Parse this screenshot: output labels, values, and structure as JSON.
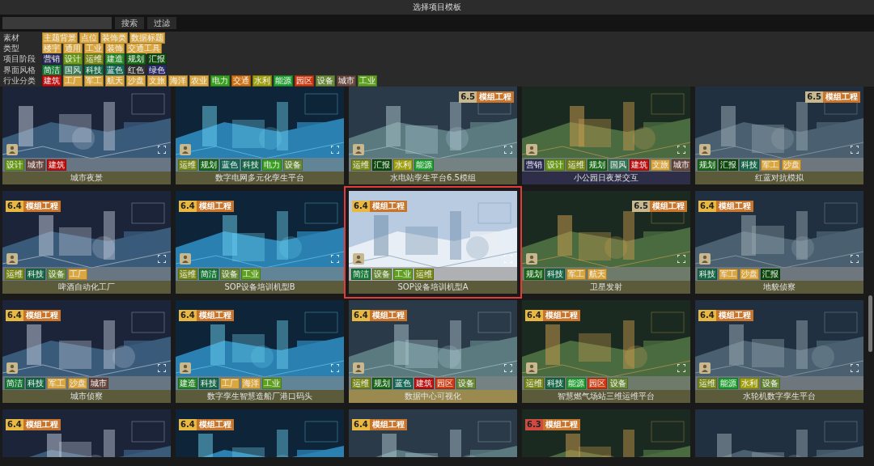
{
  "window": {
    "title": "选择项目模板"
  },
  "search": {
    "button": "搜索",
    "filter_button": "过滤"
  },
  "filters": [
    {
      "label": "素材",
      "tags": [
        {
          "text": "主题背景",
          "color": "#d9a640"
        },
        {
          "text": "点位",
          "color": "#d9a640"
        },
        {
          "text": "装饰类",
          "color": "#d9a640"
        },
        {
          "text": "数据标题",
          "color": "#d9a640"
        }
      ]
    },
    {
      "label": "类型",
      "tags": [
        {
          "text": "楼宇",
          "color": "#d9a640"
        },
        {
          "text": "通用",
          "color": "#d9a640"
        },
        {
          "text": "工业",
          "color": "#d9a640"
        },
        {
          "text": "装饰",
          "color": "#d9a640"
        },
        {
          "text": "交通工具",
          "color": "#d9a640"
        }
      ]
    },
    {
      "label": "项目阶段",
      "tags": [
        {
          "text": "营销",
          "color": "#2a2a55"
        },
        {
          "text": "设计",
          "color": "#6a9a1a"
        },
        {
          "text": "运维",
          "color": "#7a8a1a"
        },
        {
          "text": "建造",
          "color": "#2a8a2a"
        },
        {
          "text": "规划",
          "color": "#1a6a1a"
        },
        {
          "text": "汇报",
          "color": "#0f4a0f"
        }
      ]
    },
    {
      "label": "界面风格",
      "tags": [
        {
          "text": "简洁",
          "color": "#1a7a3a"
        },
        {
          "text": "国风",
          "color": "#3a7a5a"
        },
        {
          "text": "科技",
          "color": "#1a6a4a"
        },
        {
          "text": "蓝色",
          "color": "#1a6a5a"
        },
        {
          "text": "红色",
          "color": "#333333"
        },
        {
          "text": "绿色",
          "color": "#2a2a66"
        }
      ]
    },
    {
      "label": "行业分类",
      "tags": [
        {
          "text": "建筑",
          "color": "#c01010"
        },
        {
          "text": "工厂",
          "color": "#d9a640"
        },
        {
          "text": "军工",
          "color": "#d9a640"
        },
        {
          "text": "航天",
          "color": "#d9a640"
        },
        {
          "text": "沙盘",
          "color": "#d9a640"
        },
        {
          "text": "文旅",
          "color": "#d9a640"
        },
        {
          "text": "海洋",
          "color": "#d9a640"
        },
        {
          "text": "农业",
          "color": "#d9a640"
        },
        {
          "text": "电力",
          "color": "#3aa020"
        },
        {
          "text": "交通",
          "color": "#d07010"
        },
        {
          "text": "水利",
          "color": "#a0a010"
        },
        {
          "text": "能源",
          "color": "#20a030"
        },
        {
          "text": "园区",
          "color": "#d03a10"
        },
        {
          "text": "设备",
          "color": "#6a8a3a"
        },
        {
          "text": "城市",
          "color": "#6a4a40"
        },
        {
          "text": "工业",
          "color": "#60a020"
        }
      ]
    }
  ],
  "cards": [
    {
      "title": "城市夜景",
      "selected": false,
      "color": "#5b5b3b",
      "tags": [
        {
          "text": "设计",
          "color": "#6a9a1a"
        },
        {
          "text": "城市",
          "color": "#6a4a40"
        },
        {
          "text": "建筑",
          "color": "#c01010"
        }
      ]
    },
    {
      "title": "数字电网多元化孪生平台",
      "selected": false,
      "color": "#5b5b3b",
      "tags": [
        {
          "text": "运维",
          "color": "#7a8a1a"
        },
        {
          "text": "规划",
          "color": "#1a6a1a"
        },
        {
          "text": "蓝色",
          "color": "#1a6a5a"
        },
        {
          "text": "科技",
          "color": "#1a6a4a"
        },
        {
          "text": "电力",
          "color": "#3aa020"
        },
        {
          "text": "设备",
          "color": "#6a8a3a"
        }
      ]
    },
    {
      "title": "水电站孪生平台6.5模组",
      "selected": false,
      "color": "#5b5b3b",
      "badge": {
        "version": "6.5",
        "text": "模组工程",
        "color": "#c8b890",
        "align_right": true
      },
      "tags": [
        {
          "text": "运维",
          "color": "#7a8a1a"
        },
        {
          "text": "汇报",
          "color": "#0f4a0f"
        },
        {
          "text": "水利",
          "color": "#a0a010"
        },
        {
          "text": "能源",
          "color": "#20a030"
        }
      ]
    },
    {
      "title": "小公园日夜景交互",
      "selected": false,
      "color": "#2e2e48",
      "tags": [
        {
          "text": "营销",
          "color": "#2a2a55"
        },
        {
          "text": "设计",
          "color": "#6a9a1a"
        },
        {
          "text": "运维",
          "color": "#7a8a1a"
        },
        {
          "text": "规划",
          "color": "#1a6a1a"
        },
        {
          "text": "国风",
          "color": "#3a7a5a"
        },
        {
          "text": "建筑",
          "color": "#c01010"
        },
        {
          "text": "文旅",
          "color": "#d9a640"
        },
        {
          "text": "城市",
          "color": "#6a4a40"
        }
      ]
    },
    {
      "title": "红蓝对抗模拟",
      "selected": false,
      "color": "#5b5b3b",
      "badge": {
        "version": "6.5",
        "text": "模组工程",
        "color": "#c8b890",
        "align_right": true
      },
      "tags": [
        {
          "text": "规划",
          "color": "#1a6a1a"
        },
        {
          "text": "汇报",
          "color": "#0f4a0f"
        },
        {
          "text": "科技",
          "color": "#1a6a4a"
        },
        {
          "text": "军工",
          "color": "#d9a640"
        },
        {
          "text": "沙盘",
          "color": "#d9a640"
        }
      ]
    },
    {
      "title": "啤酒自动化工厂",
      "selected": false,
      "color": "#5b5b3b",
      "badge": {
        "version": "6.4",
        "text": "模组工程",
        "color": "#e8b840"
      },
      "tags": [
        {
          "text": "运维",
          "color": "#7a8a1a"
        },
        {
          "text": "科技",
          "color": "#1a6a4a"
        },
        {
          "text": "设备",
          "color": "#6a8a3a"
        },
        {
          "text": "工厂",
          "color": "#d9a640"
        }
      ]
    },
    {
      "title": "SOP设备培训机型B",
      "selected": false,
      "color": "#5b5b3b",
      "badge": {
        "version": "6.4",
        "text": "模组工程",
        "color": "#e8b840"
      },
      "tags": [
        {
          "text": "运维",
          "color": "#7a8a1a"
        },
        {
          "text": "简洁",
          "color": "#1a7a3a"
        },
        {
          "text": "设备",
          "color": "#6a8a3a"
        },
        {
          "text": "工业",
          "color": "#60a020"
        }
      ]
    },
    {
      "title": "SOP设备培训机型A",
      "selected": true,
      "color": "#5b5b3b",
      "badge": {
        "version": "6.4",
        "text": "模组工程",
        "color": "#e8b840"
      },
      "tags": [
        {
          "text": "简洁",
          "color": "#1a7a3a"
        },
        {
          "text": "设备",
          "color": "#6a8a3a"
        },
        {
          "text": "工业",
          "color": "#60a020"
        },
        {
          "text": "运维",
          "color": "#7a8a1a"
        }
      ]
    },
    {
      "title": "卫星发射",
      "selected": false,
      "color": "#5b5b3b",
      "badge": {
        "version": "6.5",
        "text": "模组工程",
        "color": "#c8b890",
        "align_right": true
      },
      "tags": [
        {
          "text": "规划",
          "color": "#1a6a1a"
        },
        {
          "text": "科技",
          "color": "#1a6a4a"
        },
        {
          "text": "军工",
          "color": "#d9a640"
        },
        {
          "text": "航天",
          "color": "#d9a640"
        }
      ]
    },
    {
      "title": "地貌侦察",
      "selected": false,
      "color": "#5b5b3b",
      "badge": {
        "version": "6.4",
        "text": "模组工程",
        "color": "#e8b840"
      },
      "tags": [
        {
          "text": "科技",
          "color": "#1a6a4a"
        },
        {
          "text": "军工",
          "color": "#d9a640"
        },
        {
          "text": "沙盘",
          "color": "#d9a640"
        },
        {
          "text": "汇报",
          "color": "#0f4a0f"
        }
      ]
    },
    {
      "title": "城市侦察",
      "selected": false,
      "color": "#5b5b3b",
      "badge": {
        "version": "6.4",
        "text": "模组工程",
        "color": "#e8b840"
      },
      "tags": [
        {
          "text": "简洁",
          "color": "#1a7a3a"
        },
        {
          "text": "科技",
          "color": "#1a6a4a"
        },
        {
          "text": "军工",
          "color": "#d9a640"
        },
        {
          "text": "沙盘",
          "color": "#d9a640"
        },
        {
          "text": "城市",
          "color": "#6a4a40"
        }
      ]
    },
    {
      "title": "数字孪生智慧造船厂港口码头",
      "selected": false,
      "color": "#5b5b3b",
      "badge": {
        "version": "6.4",
        "text": "模组工程",
        "color": "#e8b840"
      },
      "tags": [
        {
          "text": "建造",
          "color": "#2a8a2a"
        },
        {
          "text": "科技",
          "color": "#1a6a4a"
        },
        {
          "text": "工厂",
          "color": "#d9a640"
        },
        {
          "text": "海洋",
          "color": "#d9a640"
        },
        {
          "text": "工业",
          "color": "#60a020"
        }
      ]
    },
    {
      "title": "数据中心可视化",
      "selected": false,
      "color": "#9a8a50",
      "badge": {
        "version": "6.4",
        "text": "模组工程",
        "color": "#e8b840"
      },
      "tags": [
        {
          "text": "运维",
          "color": "#7a8a1a"
        },
        {
          "text": "规划",
          "color": "#1a6a1a"
        },
        {
          "text": "蓝色",
          "color": "#1a6a5a"
        },
        {
          "text": "建筑",
          "color": "#c01010"
        },
        {
          "text": "园区",
          "color": "#d03a10"
        },
        {
          "text": "设备",
          "color": "#6a8a3a"
        }
      ]
    },
    {
      "title": "智慧燃气场站三维运维平台",
      "selected": false,
      "color": "#5b5b3b",
      "badge": {
        "version": "6.4",
        "text": "模组工程",
        "color": "#e8b840"
      },
      "tags": [
        {
          "text": "运维",
          "color": "#7a8a1a"
        },
        {
          "text": "科技",
          "color": "#1a6a4a"
        },
        {
          "text": "能源",
          "color": "#20a030"
        },
        {
          "text": "园区",
          "color": "#d03a10"
        },
        {
          "text": "设备",
          "color": "#6a8a3a"
        }
      ]
    },
    {
      "title": "水轮机数字孪生平台",
      "selected": false,
      "color": "#5b5b3b",
      "badge": {
        "version": "6.4",
        "text": "模组工程",
        "color": "#e8b840"
      },
      "tags": [
        {
          "text": "运维",
          "color": "#7a8a1a"
        },
        {
          "text": "能源",
          "color": "#20a030"
        },
        {
          "text": "水利",
          "color": "#a0a010"
        },
        {
          "text": "设备",
          "color": "#6a8a3a"
        }
      ]
    },
    {
      "selected": false,
      "badge": {
        "version": "6.4",
        "text": "模组工程",
        "color": "#e8b840"
      }
    },
    {
      "selected": false,
      "badge": {
        "version": "6.4",
        "text": "模组工程",
        "color": "#e8b840"
      }
    },
    {
      "selected": false,
      "badge": {
        "version": "6.4",
        "text": "模组工程",
        "color": "#e8b840"
      }
    },
    {
      "selected": false,
      "badge": {
        "version": "6.3",
        "text": "模组工程",
        "color": "#d04a40"
      }
    },
    {
      "selected": false
    }
  ]
}
